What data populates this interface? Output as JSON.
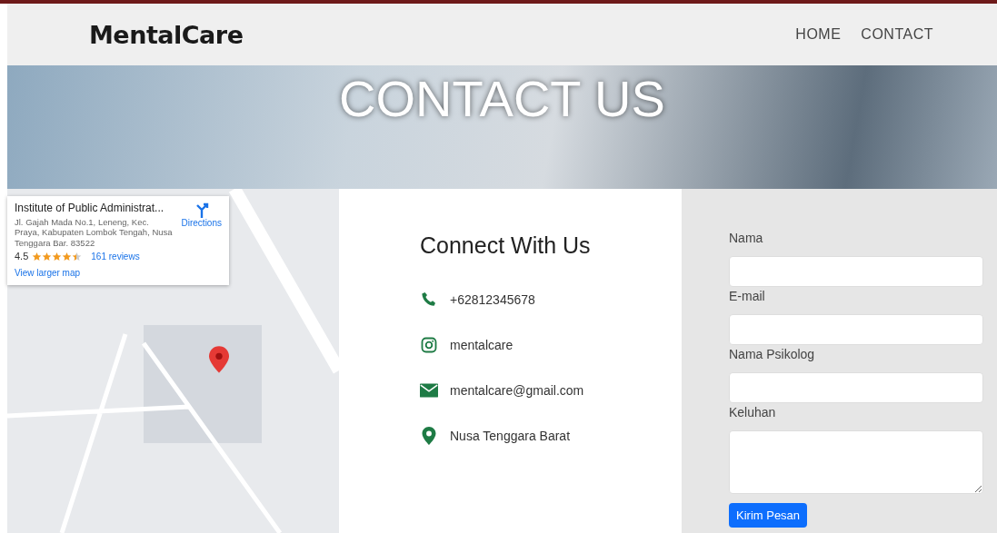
{
  "navbar": {
    "brand": "MentalCare",
    "links": [
      {
        "label": "HOME",
        "selected": false
      },
      {
        "label": "CONTACT",
        "selected": false
      }
    ]
  },
  "hero": {
    "title": "CONTACT US"
  },
  "map_card": {
    "place": "Institute of Public Administrat...",
    "address": "Jl. Gajah Mada No.1, Leneng, Kec. Praya, Kabupaten Lombok Tengah, Nusa Tenggara Bar. 83522",
    "rating": "4.5",
    "stars": 4.5,
    "reviews": "161 reviews",
    "directions": "Directions",
    "larger_map": "View larger map"
  },
  "connect": {
    "heading": "Connect With Us",
    "items": [
      {
        "kind": "phone",
        "text": "+62812345678"
      },
      {
        "kind": "instagram",
        "text": "mentalcare"
      },
      {
        "kind": "email",
        "text": "mentalcare@gmail.com"
      },
      {
        "kind": "location",
        "text": "Nusa Tenggara Barat"
      }
    ]
  },
  "form": {
    "fields": [
      {
        "label": "Nama",
        "kind": "input"
      },
      {
        "label": "E-mail",
        "kind": "input"
      },
      {
        "label": "Nama Psikolog",
        "kind": "input"
      },
      {
        "label": "Keluhan",
        "kind": "textarea"
      }
    ],
    "submit": "Kirim Pesan"
  }
}
